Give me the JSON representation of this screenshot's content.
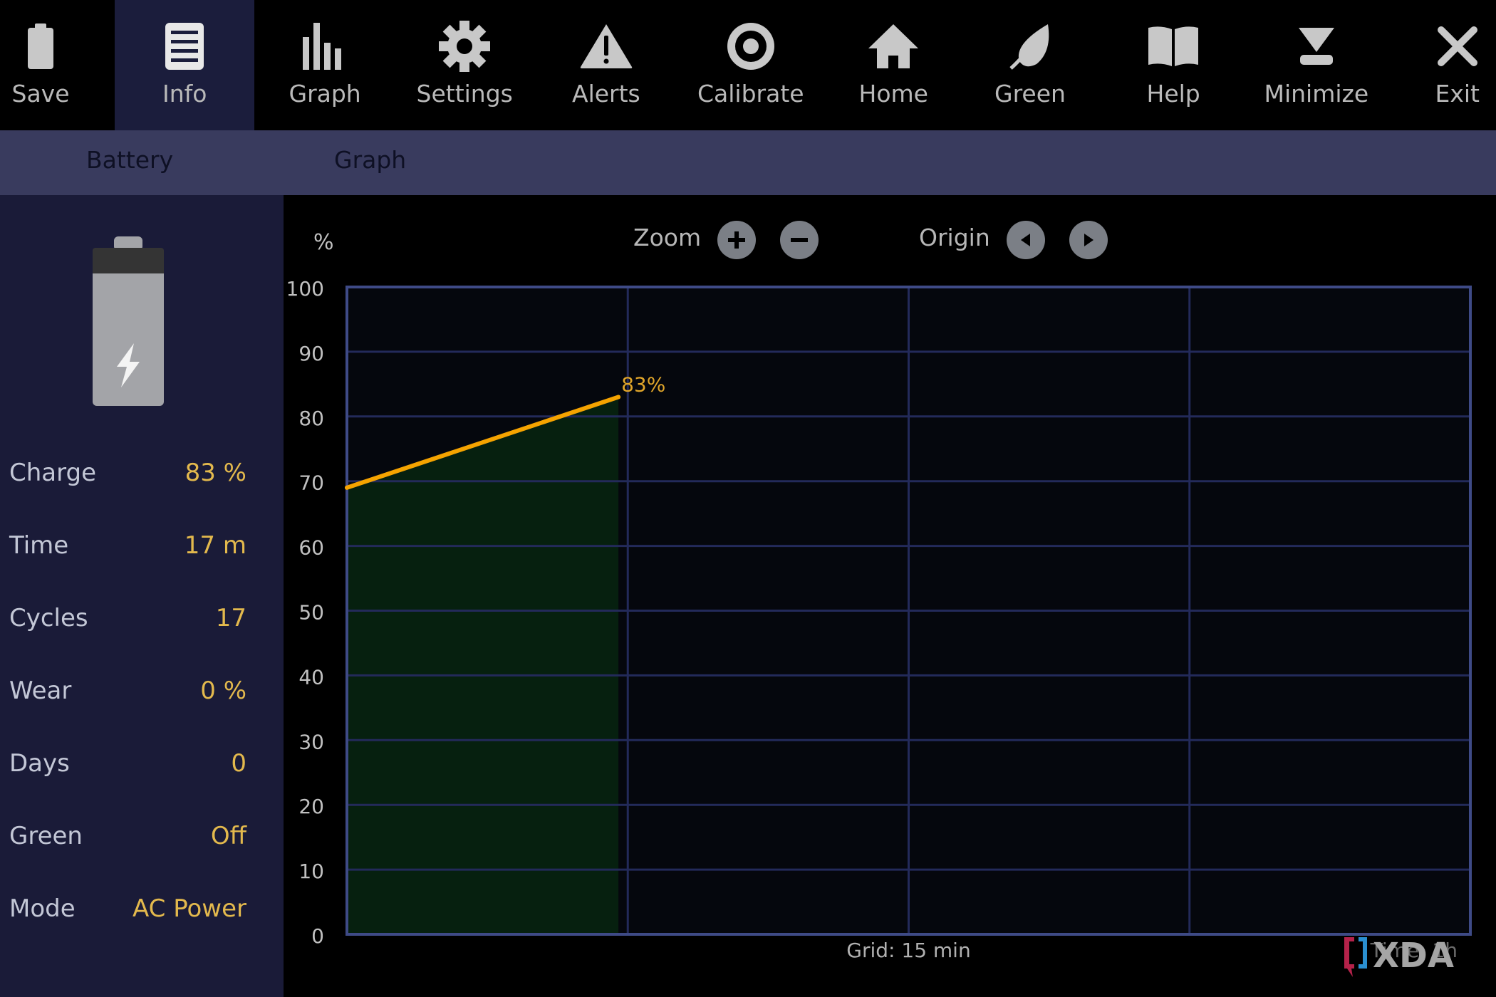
{
  "toolbar": {
    "items": [
      {
        "label": "Save",
        "icon": "battery-icon"
      },
      {
        "label": "Info",
        "icon": "document-list-icon",
        "active": true
      },
      {
        "label": "Graph",
        "icon": "bar-chart-icon"
      },
      {
        "label": "Settings",
        "icon": "gear-icon"
      },
      {
        "label": "Alerts",
        "icon": "warning-icon"
      },
      {
        "label": "Calibrate",
        "icon": "target-icon"
      },
      {
        "label": "Home",
        "icon": "home-icon"
      },
      {
        "label": "Green",
        "icon": "leaf-icon"
      },
      {
        "label": "Help",
        "icon": "book-icon"
      },
      {
        "label": "Minimize",
        "icon": "minimize-icon"
      },
      {
        "label": "Exit",
        "icon": "close-icon"
      }
    ]
  },
  "subtabs": {
    "battery": "Battery",
    "graph": "Graph"
  },
  "sidebar": {
    "battery_state": "charging",
    "stats": [
      {
        "label": "Charge",
        "value": "83 %"
      },
      {
        "label": "Time",
        "value": "17 m"
      },
      {
        "label": "Cycles",
        "value": "17"
      },
      {
        "label": "Wear",
        "value": "0 %"
      },
      {
        "label": "Days",
        "value": "0"
      },
      {
        "label": "Green",
        "value": "Off"
      },
      {
        "label": "Mode",
        "value": "AC Power"
      }
    ]
  },
  "graph_controls": {
    "zoom_label": "Zoom",
    "origin_label": "Origin"
  },
  "colors": {
    "line": "#f5a300",
    "fill": "#06200f",
    "grid": "#232a5a",
    "frame": "#3e4a86",
    "value_text": "#e3b94d"
  },
  "chart_data": {
    "type": "area",
    "ylabel": "%",
    "ylim": [
      0,
      100
    ],
    "yticks": [
      0,
      10,
      20,
      30,
      40,
      50,
      60,
      70,
      80,
      90,
      100
    ],
    "xlim_minutes": [
      0,
      60
    ],
    "x_grid_minutes": 15,
    "grid": true,
    "footer_grid": "Grid: 15 min",
    "footer_time": "Time: 1h",
    "series": [
      {
        "name": "Charge",
        "x_minutes": [
          0,
          14.5
        ],
        "values": [
          69,
          83
        ]
      }
    ],
    "annotation": {
      "text": "83%",
      "x_minutes": 14.5,
      "value": 83
    }
  },
  "watermark": "XDA"
}
